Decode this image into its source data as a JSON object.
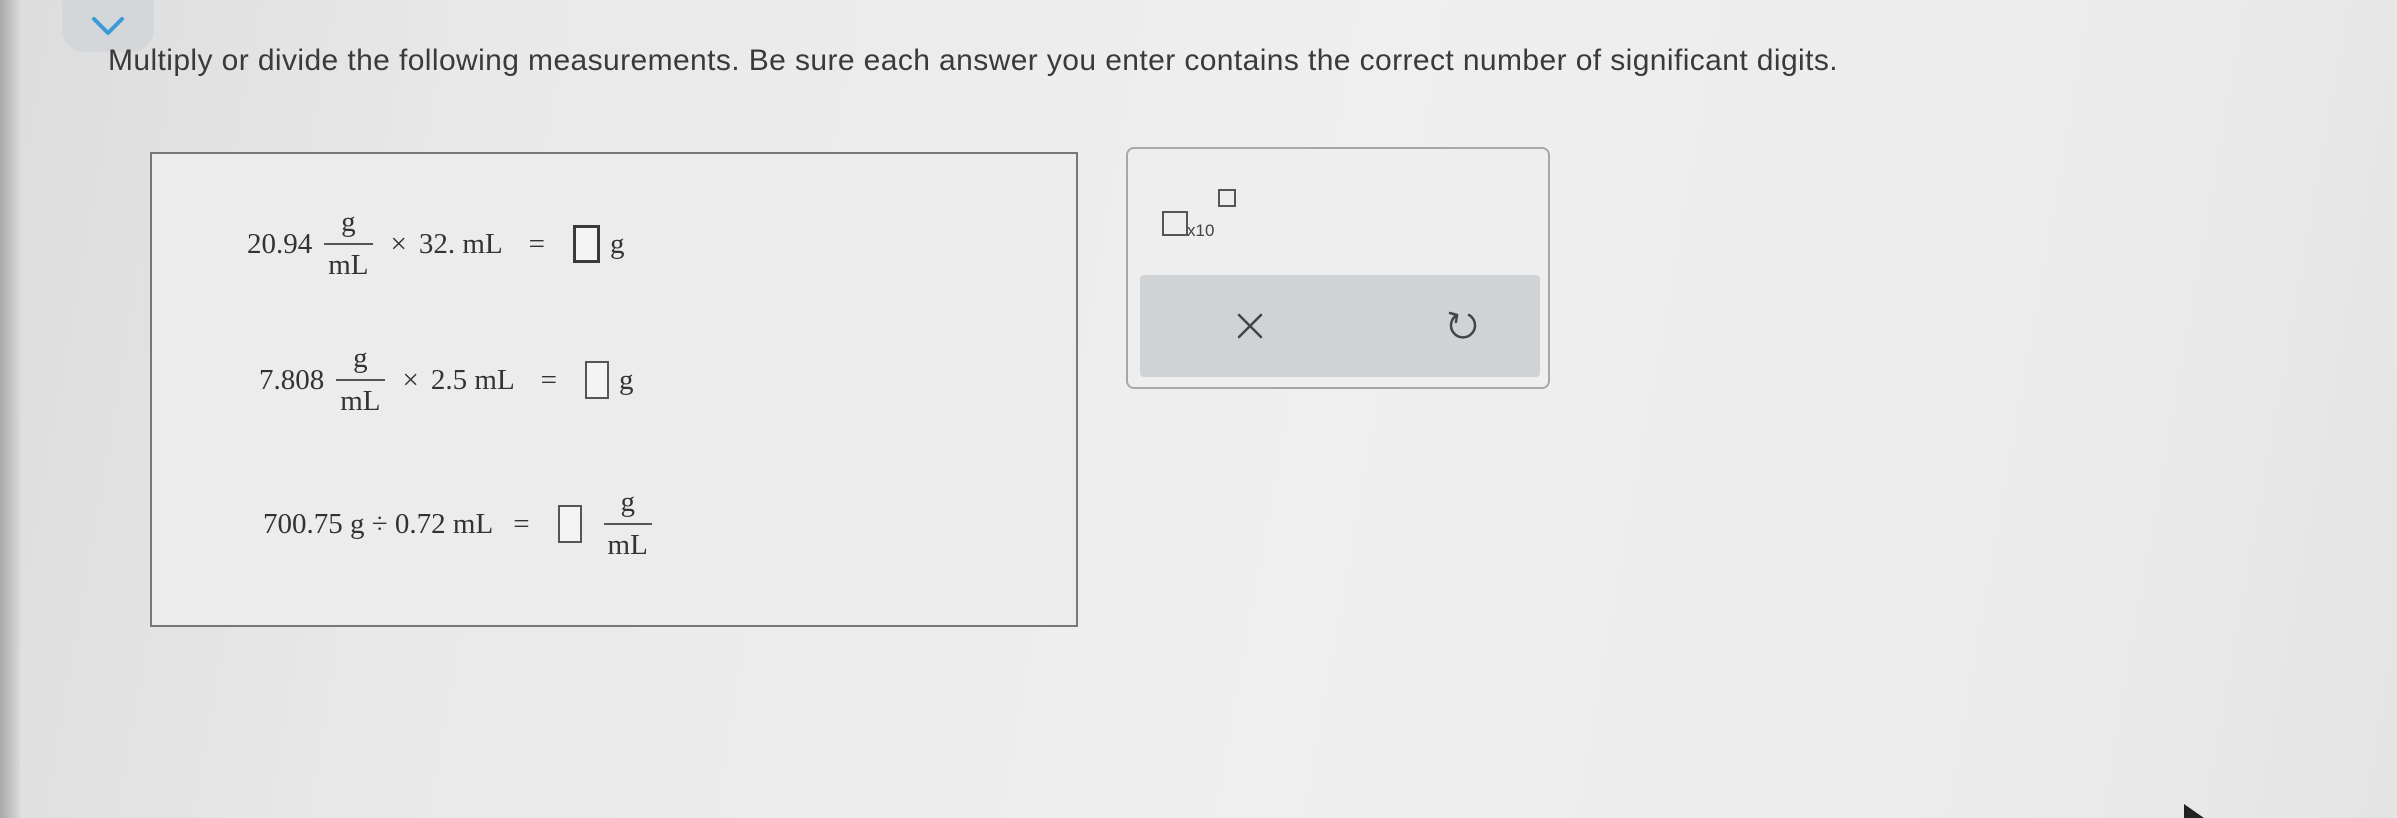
{
  "header": {
    "instruction": "Multiply or divide the following measurements. Be sure each answer you enter contains the correct number of significant digits.",
    "collapse_icon": "chevron-down-icon",
    "accent_color": "#3a9ad9"
  },
  "problems": [
    {
      "value": "20.94",
      "unit_num": "g",
      "unit_den": "mL",
      "operator": "×",
      "operand": "32. mL",
      "equals": "=",
      "answer": "",
      "answer_unit": "g"
    },
    {
      "value": "7.808",
      "unit_num": "g",
      "unit_den": "mL",
      "operator": "×",
      "operand": "2.5 mL",
      "equals": "=",
      "answer": "",
      "answer_unit": "g"
    },
    {
      "expression": "700.75 g ÷ 0.72 mL",
      "equals": "=",
      "answer": "",
      "answer_unit_num": "g",
      "answer_unit_den": "mL"
    }
  ],
  "tools": {
    "sci_notation_label": "x10",
    "clear_icon": "close-icon",
    "undo_icon": "undo-icon"
  }
}
